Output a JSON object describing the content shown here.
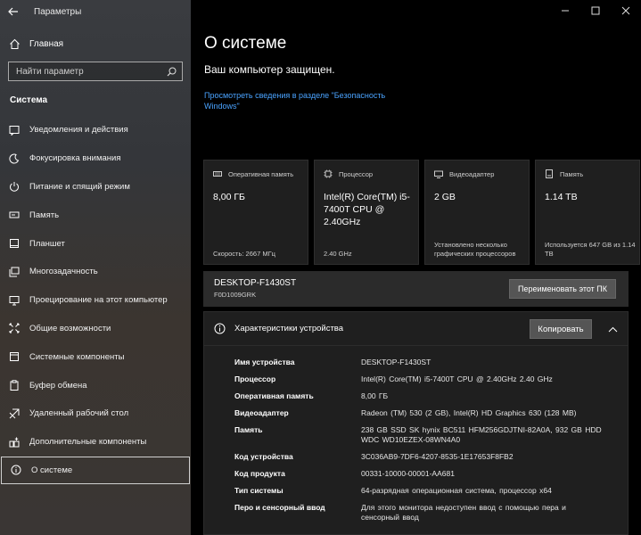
{
  "app": {
    "title": "Параметры"
  },
  "sidebar": {
    "home_label": "Главная",
    "search_placeholder": "Найти параметр",
    "section_title": "Система",
    "items": [
      {
        "label": "Уведомления и действия",
        "icon": "notification-icon"
      },
      {
        "label": "Фокусировка внимания",
        "icon": "moon-icon"
      },
      {
        "label": "Питание и спящий режим",
        "icon": "power-icon"
      },
      {
        "label": "Память",
        "icon": "storage-icon"
      },
      {
        "label": "Планшет",
        "icon": "tablet-icon"
      },
      {
        "label": "Многозадачность",
        "icon": "multitasking-icon"
      },
      {
        "label": "Проецирование на этот компьютер",
        "icon": "projection-icon"
      },
      {
        "label": "Общие возможности",
        "icon": "shared-experiences-icon"
      },
      {
        "label": "Системные компоненты",
        "icon": "system-components-icon"
      },
      {
        "label": "Буфер обмена",
        "icon": "clipboard-icon"
      },
      {
        "label": "Удаленный рабочий стол",
        "icon": "remote-desktop-icon"
      },
      {
        "label": "Дополнительные компоненты",
        "icon": "optional-features-icon"
      },
      {
        "label": "О системе",
        "icon": "info-icon",
        "selected": true
      }
    ]
  },
  "main": {
    "title": "О системе",
    "protected_text": "Ваш компьютер защищен.",
    "security_link": "Просмотреть сведения в разделе \"Безопасность Windows\"",
    "cards": [
      {
        "title": "Оперативная память",
        "value": "8,00 ГБ",
        "foot": "Скорость: 2667 МГц",
        "icon": "ram-icon"
      },
      {
        "title": "Процессор",
        "value": "Intel(R) Core(TM) i5-7400T CPU @ 2.40GHz",
        "foot": "2.40 GHz",
        "icon": "cpu-icon"
      },
      {
        "title": "Видеоадаптер",
        "value": "2 GB",
        "foot": "Установлено несколько графических процессоров",
        "icon": "gpu-icon"
      },
      {
        "title": "Память",
        "value": "1.14 TB",
        "foot": "Используется 647 GB из 1.14 TB",
        "icon": "disk-icon"
      }
    ],
    "device": {
      "name": "DESKTOP-F1430ST",
      "id": "F0D1009GRK",
      "rename_label": "Переименовать этот ПК"
    },
    "specs": {
      "title": "Характеристики устройства",
      "copy_label": "Копировать",
      "rows": [
        {
          "key": "Имя устройства",
          "value": "DESKTOP-F1430ST"
        },
        {
          "key": "Процессор",
          "value": "Intel(R) Core(TM) i5-7400T CPU @ 2.40GHz   2.40 GHz"
        },
        {
          "key": "Оперативная память",
          "value": "8,00 ГБ"
        },
        {
          "key": "Видеоадаптер",
          "value": "Radeon (TM) 530 (2 GB), Intel(R) HD Graphics 630 (128 MB)"
        },
        {
          "key": "Память",
          "value": "238 GB SSD SK hynix BC511 HFM256GDJTNI-82A0A, 932 GB HDD WDC WD10EZEX-08WN4A0"
        },
        {
          "key": "Код устройства",
          "value": "3C036AB9-7DF6-4207-8535-1E17653F8FB2"
        },
        {
          "key": "Код продукта",
          "value": "00331-10000-00001-AA681"
        },
        {
          "key": "Тип системы",
          "value": "64-разрядная операционная система, процессор x64"
        },
        {
          "key": "Перо и сенсорный ввод",
          "value": "Для этого монитора недоступен ввод с помощью пера и сенсорный ввод"
        }
      ]
    }
  },
  "colors": {
    "link": "#4aa3ff",
    "card_bg": "#1f1f1f",
    "button_bg": "#555555"
  }
}
